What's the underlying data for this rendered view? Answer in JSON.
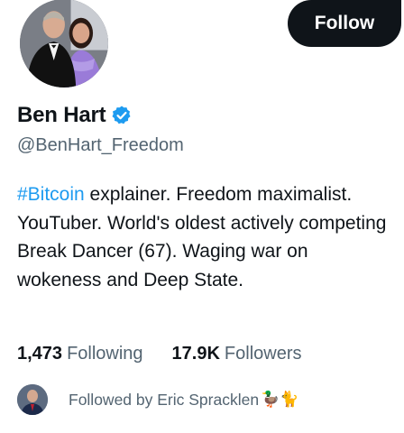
{
  "profile": {
    "name": "Ben Hart",
    "handle": "@BenHart_Freedom",
    "verified_icon": "verified-badge-icon",
    "bio_hashtag": "#Bitcoin",
    "bio_rest": " explainer. Freedom maximalist. YouTuber. World's oldest actively competing Break Dancer (67). Waging war on  wokeness and Deep State."
  },
  "actions": {
    "follow_label": "Follow"
  },
  "stats": {
    "following_count": "1,473",
    "following_label": "Following",
    "followers_count": "17.9K",
    "followers_label": "Followers"
  },
  "followed_by": {
    "text": "Followed by Eric Spracklen",
    "emojis": "🦆🐈"
  },
  "colors": {
    "accent": "#1d9bf0",
    "text_primary": "#0f1419",
    "text_secondary": "#536471",
    "button_bg": "#0f1419"
  }
}
